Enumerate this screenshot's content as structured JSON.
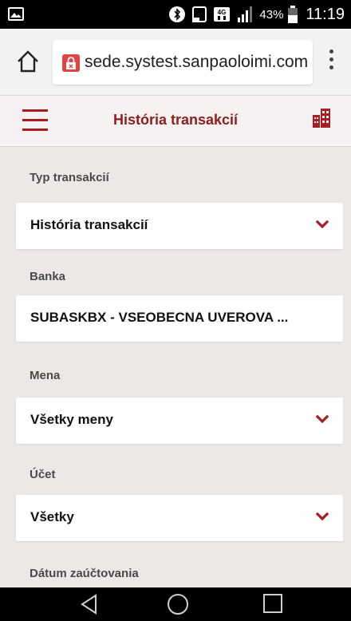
{
  "status_bar": {
    "battery_percent": "43%",
    "time": "11:19",
    "network": "4G"
  },
  "browser": {
    "url": "sede.systest.sanpaoloimi.com",
    "home_icon": "home-icon",
    "menu_icon": "overflow-menu-icon"
  },
  "header": {
    "title": "História transakcií",
    "menu_icon": "hamburger-icon",
    "right_icon": "bank-building-icon",
    "accent_color": "#a61e22"
  },
  "form": {
    "fields": [
      {
        "label": "Typ transakcií",
        "value": "História transakcií",
        "dropdown": true
      },
      {
        "label": "Banka",
        "value": "SUBASKBX - VSEOBECNA UVEROVA ...",
        "dropdown": false
      },
      {
        "label": "Mena",
        "value": "Všetky meny",
        "dropdown": true
      },
      {
        "label": "Účet",
        "value": "Všetky",
        "dropdown": true
      },
      {
        "label": "Dátum zaúčtovania",
        "value": "",
        "dropdown": false
      }
    ]
  }
}
